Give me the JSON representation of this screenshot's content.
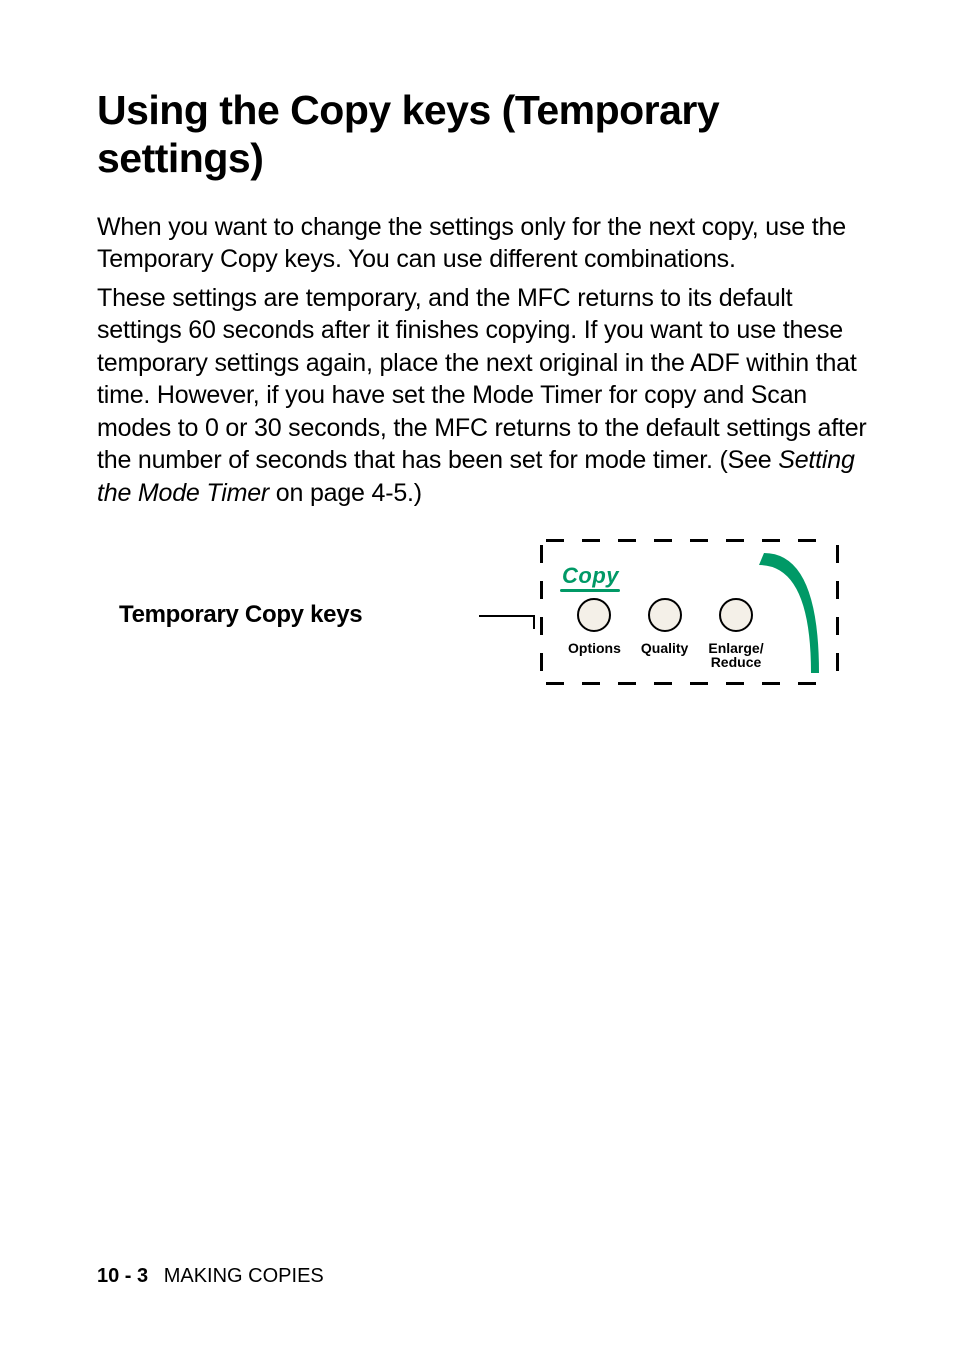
{
  "heading": "Using the Copy keys (Temporary settings)",
  "para1": "When you want to change the settings only for the next copy, use the Temporary Copy keys. You can use different combinations.",
  "para2a": "These settings are temporary, and the MFC returns to its default settings 60 seconds after it finishes copying. If you want to use these temporary settings again, place the next original in the ADF within that time. However, if you have set the Mode Timer for copy and Scan modes to 0 or 30 seconds, the MFC returns to the default settings after the number of seconds that has been set for mode timer. (See ",
  "para2b_italic": "Setting the Mode Timer",
  "para2c": " on page 4-5.)",
  "figure": {
    "callout_label": "Temporary Copy keys",
    "panel_title": "Copy",
    "buttons": {
      "options": "Options",
      "quality": "Quality",
      "enlarge_reduce": "Enlarge/\nReduce"
    }
  },
  "footer": {
    "page_number": "10 - 3",
    "section": "MAKING COPIES"
  }
}
